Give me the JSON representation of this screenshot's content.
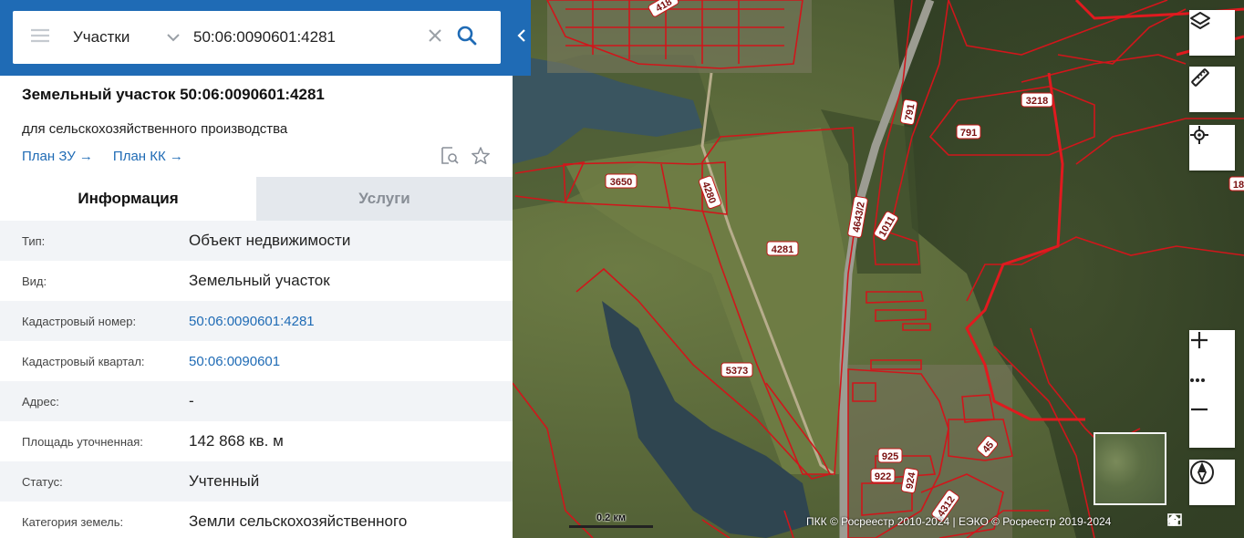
{
  "search": {
    "type_label": "Участки",
    "query": "50:06:0090601:4281"
  },
  "object": {
    "title": "Земельный участок 50:06:0090601:4281",
    "subtitle": "для сельскохозяйственного производства",
    "plan_zu": "План ЗУ",
    "plan_kk": "План КК"
  },
  "tabs": [
    {
      "label": "Информация",
      "active": true
    },
    {
      "label": "Услуги",
      "active": false
    }
  ],
  "info_rows": [
    {
      "label": "Тип:",
      "value": "Объект недвижимости",
      "link": false
    },
    {
      "label": "Вид:",
      "value": "Земельный участок",
      "link": false
    },
    {
      "label": "Кадастровый номер:",
      "value": "50:06:0090601:4281",
      "link": true
    },
    {
      "label": "Кадастровый квартал:",
      "value": "50:06:0090601",
      "link": true
    },
    {
      "label": "Адрес:",
      "value": "-",
      "link": false
    },
    {
      "label": "Площадь уточненная:",
      "value": "142 868 кв. м",
      "link": false
    },
    {
      "label": "Статус:",
      "value": "Учтенный",
      "link": false
    },
    {
      "label": "Категория земель:",
      "value": "Земли сельскохозяйственного",
      "link": false
    }
  ],
  "map": {
    "parcel_labels": [
      "418",
      "3650",
      "4280",
      "4281",
      "5373",
      "1011",
      "4643/2",
      "791",
      "791",
      "3218",
      "18",
      "925",
      "922",
      "924",
      "45",
      "4312"
    ],
    "scale_label": "0.2 км",
    "attribution": "ПКК © Росреестр 2010-2024 | ЕЭКО © Росреестр 2019-2024"
  },
  "colors": {
    "header_blue": "#1f6bb5",
    "parcel_red": "#d0161b",
    "link_blue": "#1f6bb5"
  },
  "icons": {
    "menu": "hamburger-icon",
    "clear": "close-icon",
    "search": "search-icon",
    "layers": "layers-icon",
    "ruler": "ruler-icon",
    "locate": "crosshair-icon",
    "zoom_in": "plus-icon",
    "zoom_out": "minus-icon",
    "compass": "compass-icon"
  }
}
